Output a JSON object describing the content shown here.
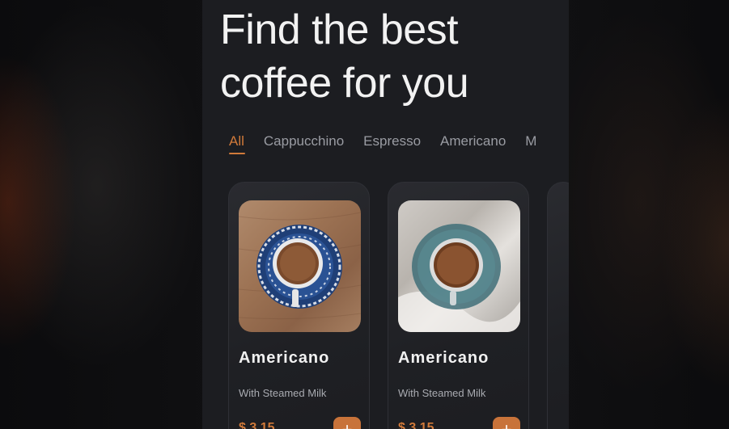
{
  "header": {
    "line1": "Find the best",
    "line2": "coffee for you"
  },
  "tabs": [
    {
      "label": "All",
      "active": true
    },
    {
      "label": "Cappucchino",
      "active": false
    },
    {
      "label": "Espresso",
      "active": false
    },
    {
      "label": "Americano",
      "active": false
    },
    {
      "label": "M",
      "active": false
    }
  ],
  "products": [
    {
      "name": "Americano",
      "subtitle": "With Steamed Milk",
      "price": "$ 3.15",
      "add_label": "+"
    },
    {
      "name": "Americano",
      "subtitle": "With Steamed Milk",
      "price": "$ 3.15",
      "add_label": "+"
    }
  ],
  "colors": {
    "accent": "#d17a3a",
    "background": "#1c1d21",
    "card": "#26272c"
  }
}
